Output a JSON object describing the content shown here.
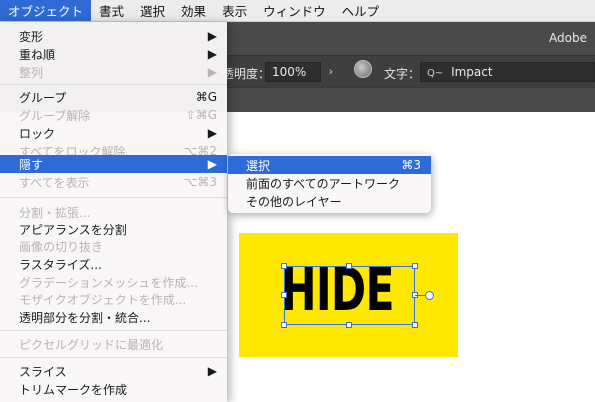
{
  "menubar": {
    "items": [
      "オブジェクト",
      "書式",
      "選択",
      "効果",
      "表示",
      "ウィンドウ",
      "ヘルプ"
    ]
  },
  "app": {
    "title": "Adobe"
  },
  "controlbar": {
    "opacity_label": "透明度：",
    "opacity_value": "100%",
    "opacity_arrow": "›",
    "char_label": "文字：",
    "search_glyph": "Q~",
    "font_value": "Impact"
  },
  "menu": {
    "items": [
      {
        "label": "変形",
        "shortcut": "▶",
        "state": "enabled"
      },
      {
        "label": "重ね順",
        "shortcut": "▶",
        "state": "enabled"
      },
      {
        "label": "整列",
        "shortcut": "▶",
        "state": "disabled"
      },
      {
        "label": "グループ",
        "shortcut": "⌘G",
        "state": "enabled"
      },
      {
        "label": "グループ解除",
        "shortcut": "⇧⌘G",
        "state": "disabled"
      },
      {
        "label": "ロック",
        "shortcut": "▶",
        "state": "enabled"
      },
      {
        "label": "すべてをロック解除",
        "shortcut": "⌥⌘2",
        "state": "disabled"
      },
      {
        "label": "隠す",
        "shortcut": "▶",
        "state": "highlighted"
      },
      {
        "label": "すべてを表示",
        "shortcut": "⌥⌘3",
        "state": "disabled"
      },
      {
        "label": "分割・拡張...",
        "shortcut": "",
        "state": "disabled"
      },
      {
        "label": "アピアランスを分割",
        "shortcut": "",
        "state": "enabled"
      },
      {
        "label": "画像の切り抜き",
        "shortcut": "",
        "state": "disabled"
      },
      {
        "label": "ラスタライズ...",
        "shortcut": "",
        "state": "enabled"
      },
      {
        "label": "グラデーションメッシュを作成...",
        "shortcut": "",
        "state": "disabled"
      },
      {
        "label": "モザイクオブジェクトを作成...",
        "shortcut": "",
        "state": "disabled"
      },
      {
        "label": "透明部分を分割・統合...",
        "shortcut": "",
        "state": "enabled"
      },
      {
        "label": "ピクセルグリッドに最適化",
        "shortcut": "",
        "state": "disabled"
      },
      {
        "label": "スライス",
        "shortcut": "▶",
        "state": "enabled"
      },
      {
        "label": "トリムマークを作成",
        "shortcut": "",
        "state": "enabled"
      }
    ]
  },
  "submenu": {
    "items": [
      {
        "label": "選択",
        "shortcut": "⌘3",
        "state": "highlighted"
      },
      {
        "label": "前面のすべてのアートワーク",
        "shortcut": "",
        "state": "enabled"
      },
      {
        "label": "その他のレイヤー",
        "shortcut": "",
        "state": "enabled"
      }
    ]
  },
  "artwork": {
    "text": "HIDE",
    "background_color": "#ffe800"
  },
  "colors": {
    "accent": "#2e6bd6",
    "selection": "#3b6fe0"
  }
}
